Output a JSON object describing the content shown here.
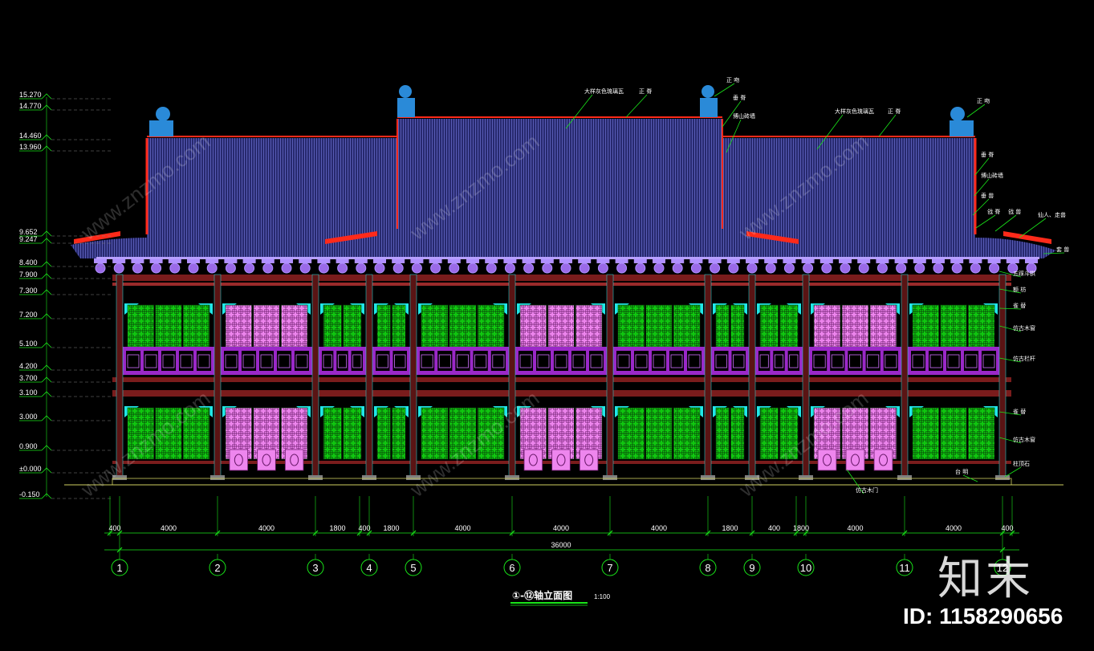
{
  "drawing": {
    "title": "①-⑫轴立面图",
    "scale": "1:100",
    "total_dimension": "36000"
  },
  "elevations": [
    "15.270",
    "14.770",
    "14.460",
    "13.960",
    "9.652",
    "9.247",
    "8.400",
    "7.900",
    "7.300",
    "7.200",
    "5.100",
    "4.200",
    "3.700",
    "3.100",
    "3.000",
    "0.900",
    "±0.000",
    "-0.150"
  ],
  "axes": [
    {
      "label": "1",
      "dim": "400"
    },
    {
      "label": "2",
      "dim": "4000"
    },
    {
      "label": "3",
      "dim": "4000"
    },
    {
      "label": "4",
      "dim": "1800"
    },
    {
      "label": "5",
      "dim": "400"
    },
    {
      "label": "6",
      "dim": "1800"
    },
    {
      "label": "7",
      "dim": "4000"
    },
    {
      "label": "8",
      "dim": "4000"
    },
    {
      "label": "9",
      "dim": "4000"
    },
    {
      "label": "10",
      "dim": "1800"
    },
    {
      "label": "11",
      "dim": "400"
    },
    {
      "label": "12",
      "dim": "1800"
    }
  ],
  "span_dims": [
    "400",
    "4000",
    "4000",
    "1800",
    "400",
    "1800",
    "4000",
    "4000",
    "4000",
    "1800",
    "400",
    "1800",
    "4000",
    "4000",
    "400"
  ],
  "annotations": {
    "roof_tile_left": "大样灰色琉璃瓦",
    "ridge_left": "正 脊",
    "roof_tile_right": "大样灰色琉璃瓦",
    "ridge_right": "正 脊",
    "zheng_wen_1": "正 吻",
    "chui_ji_1": "垂 脊",
    "boshan_1": "博山砖墙",
    "zheng_wen_2": "正 吻",
    "chui_ji_2": "垂 脊",
    "boshan_2": "博山砖墙",
    "chui_shou": "垂 兽",
    "qiang_ji": "戗 脊",
    "xianren": "仙人、走兽",
    "qiang_shou": "戗 兽",
    "tao_shou": "套 兽",
    "dougong": "五踩斗拱",
    "e_fang": "额 枋",
    "que_ti": "雀 替",
    "window_upper": "仿古木窗",
    "railing": "仿古栏杆",
    "que_ti_2": "雀 替",
    "window_lower": "仿古木窗",
    "column_base": "柱顶石",
    "platform": "台 明",
    "door": "仿古木门"
  },
  "watermark": {
    "logo": "知末",
    "id": "ID: 1158290656",
    "site": "www.znzmo.com"
  },
  "colors": {
    "roof": "#2c2e7a",
    "roof_line": "#6a6ed0",
    "column": "#7a1c1c",
    "window_green": "#18d818",
    "door_pink": "#f080f0",
    "railing": "#9a28c8",
    "bracket": "#b090ff",
    "ridge_red": "#ff2a1a",
    "cyan": "#20e8e8",
    "dim_green": "#19e619"
  }
}
